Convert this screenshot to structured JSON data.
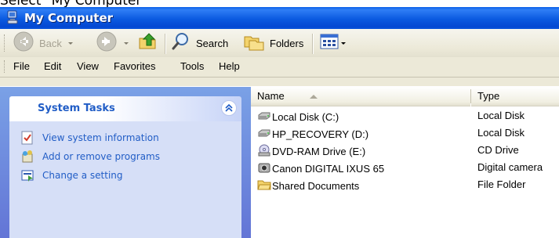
{
  "caption": "Select \"My Computer\"",
  "window": {
    "title": "My Computer"
  },
  "toolbar": {
    "back_label": "Back",
    "search_label": "Search",
    "folders_label": "Folders"
  },
  "menu": [
    "File",
    "Edit",
    "View",
    "Favorites",
    "Tools",
    "Help"
  ],
  "tasks": {
    "header": "System Tasks",
    "items": [
      {
        "label": "View system information",
        "icon": "system-info-icon"
      },
      {
        "label": "Add or remove programs",
        "icon": "add-remove-programs-icon"
      },
      {
        "label": "Change a setting",
        "icon": "control-panel-icon"
      }
    ]
  },
  "columns": {
    "name": "Name",
    "type": "Type"
  },
  "files": [
    {
      "name": "Local Disk (C:)",
      "type": "Local Disk",
      "icon": "hard-drive-icon"
    },
    {
      "name": "HP_RECOVERY (D:)",
      "type": "Local Disk",
      "icon": "hard-drive-icon"
    },
    {
      "name": "DVD-RAM Drive (E:)",
      "type": "CD Drive",
      "icon": "dvd-drive-icon"
    },
    {
      "name": "Canon DIGITAL IXUS 65",
      "type": "Digital camera",
      "icon": "camera-icon"
    },
    {
      "name": "Shared Documents",
      "type": "File Folder",
      "icon": "folder-icon"
    }
  ],
  "colors": {
    "title_blue": "#0a5fe8",
    "task_link": "#215dc6",
    "toolbar_bg": "#ece9d8"
  }
}
